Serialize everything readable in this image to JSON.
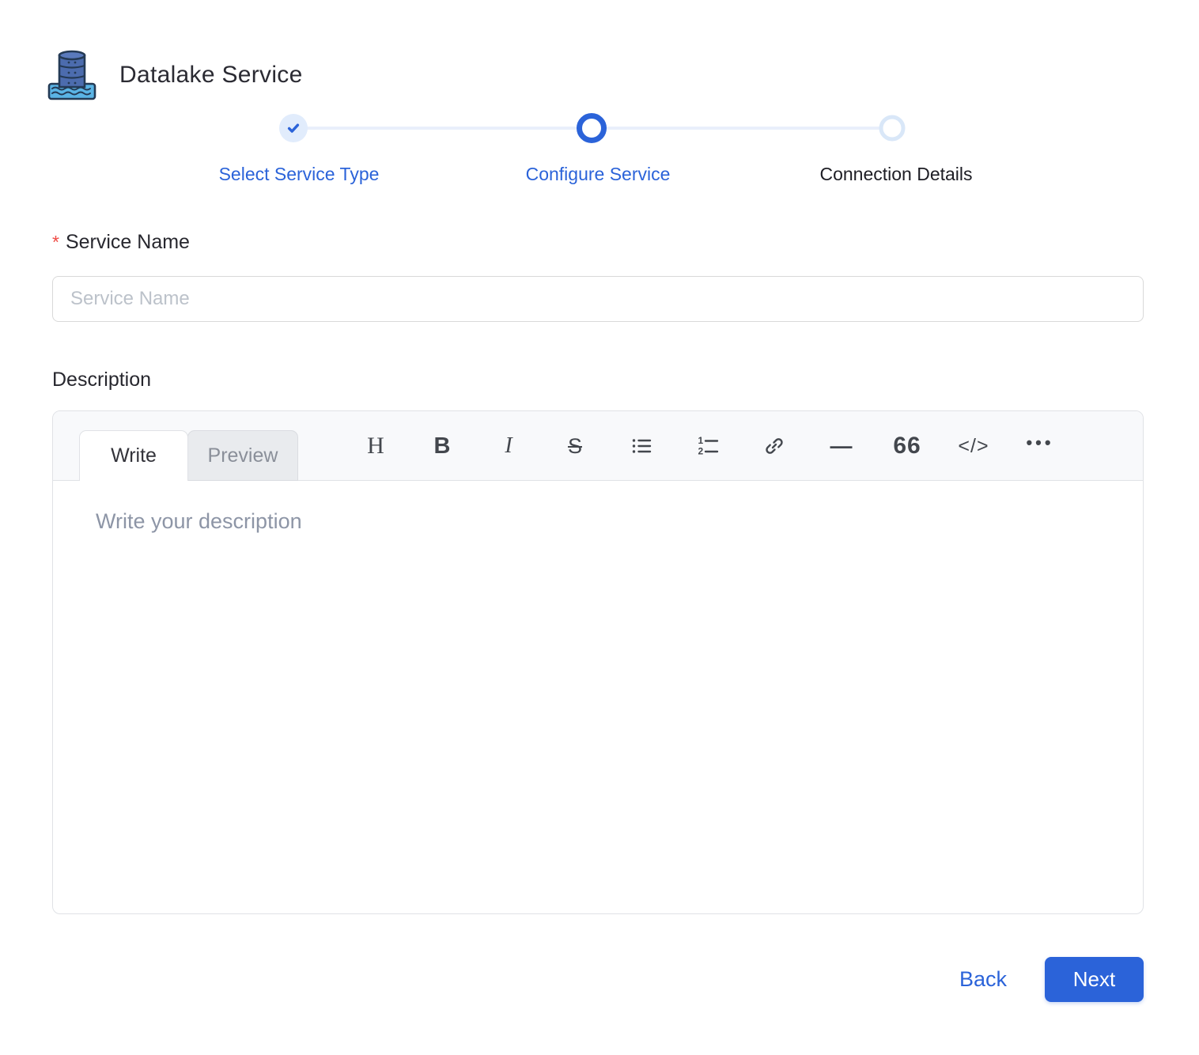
{
  "header": {
    "title": "Datalake Service"
  },
  "stepper": {
    "steps": [
      {
        "label": "Select Service Type",
        "state": "completed"
      },
      {
        "label": "Configure Service",
        "state": "active"
      },
      {
        "label": "Connection Details",
        "state": "pending"
      }
    ]
  },
  "form": {
    "required_marker": "*",
    "service_name": {
      "label": "Service Name",
      "placeholder": "Service Name",
      "value": ""
    },
    "description": {
      "label": "Description"
    }
  },
  "editor": {
    "tabs": {
      "write": "Write",
      "preview": "Preview"
    },
    "toolbar": {
      "heading": "H",
      "bold": "B",
      "italic": "I",
      "strikethrough": "S",
      "horizontal_rule": "—",
      "quote": "66",
      "code": "</>",
      "more": "•••"
    },
    "placeholder": "Write your description",
    "value": ""
  },
  "footer": {
    "back_label": "Back",
    "next_label": "Next"
  },
  "colors": {
    "primary_blue": "#2b63d9",
    "pending_ring": "#d9e7f8",
    "connector_line": "#e9effb",
    "completed_badge_bg": "#e1ecfc",
    "required_red": "#ef4b45",
    "input_placeholder": "#bcc2ca",
    "editor_placeholder": "#8d95a6",
    "text_dark": "#27272e"
  }
}
